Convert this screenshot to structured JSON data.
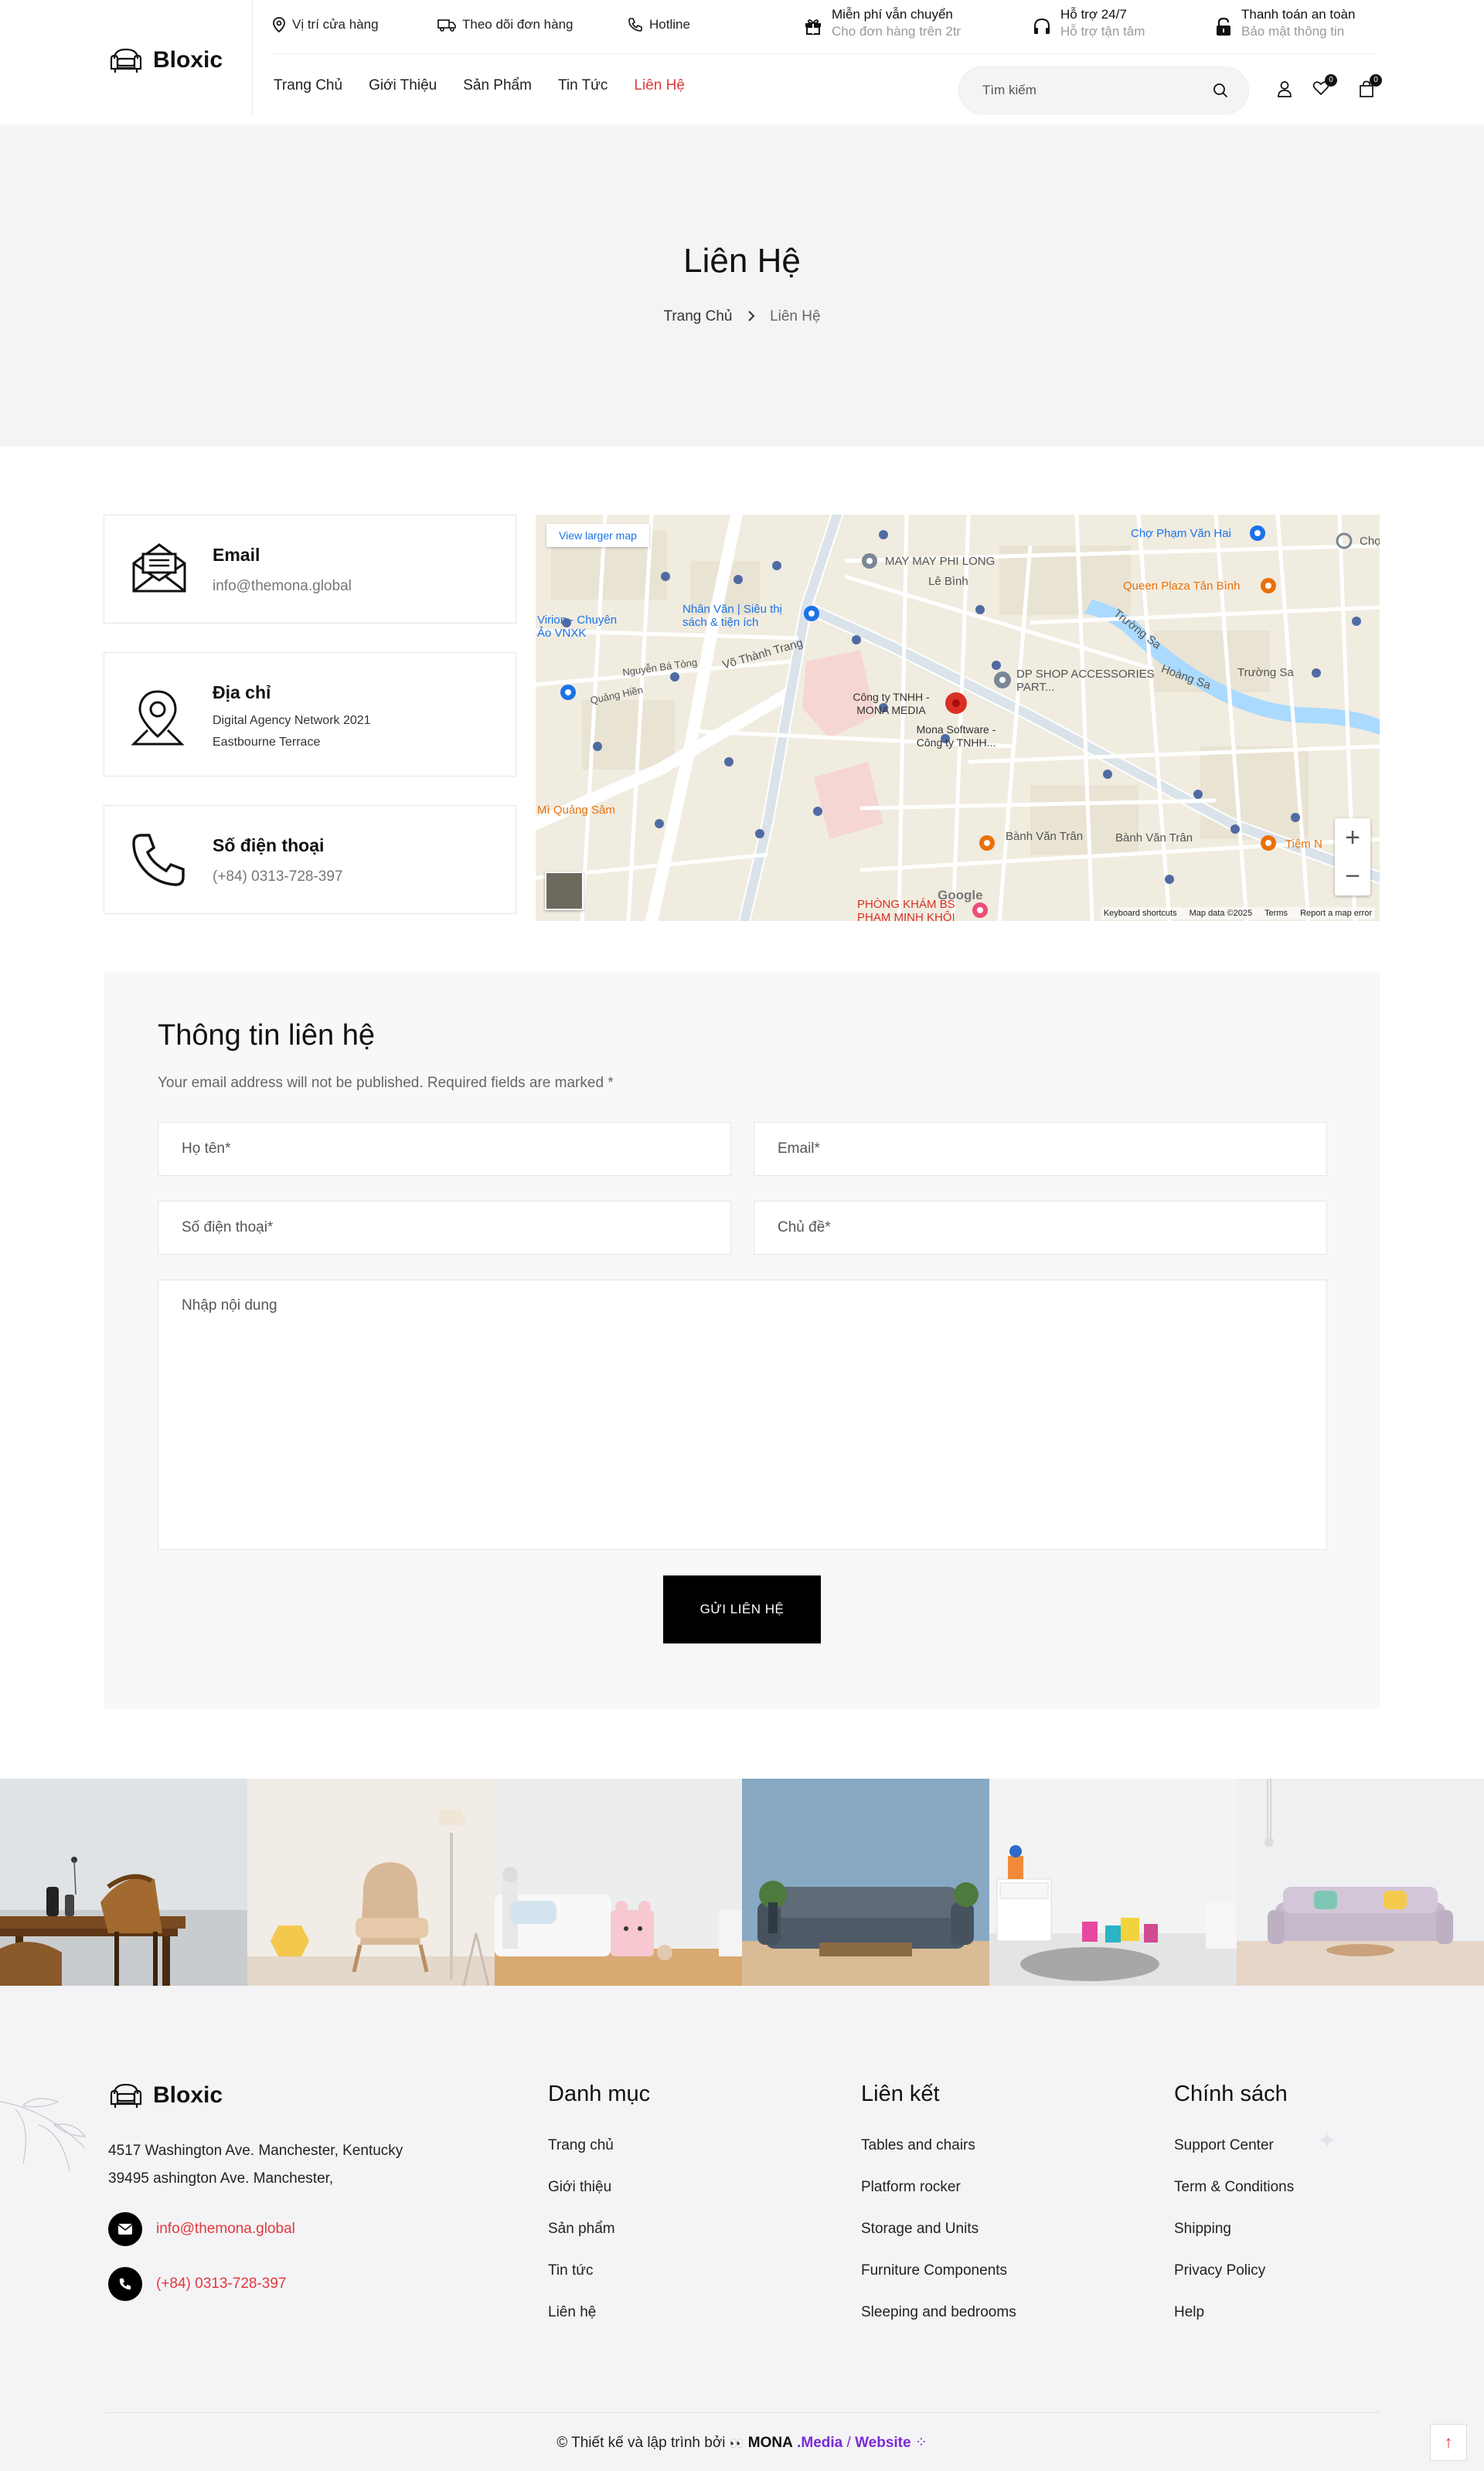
{
  "header": {
    "logo": "Bloxic",
    "top_links": [
      {
        "label": "Vị trí cửa hàng",
        "icon": "location-pin-icon"
      },
      {
        "label": "Theo dõi đơn hàng",
        "icon": "truck-icon"
      },
      {
        "label": "Hotline",
        "icon": "phone-icon"
      }
    ],
    "features": [
      {
        "title": "Miễn phí vẫn chuyển",
        "subtitle": "Cho đơn hàng trên 2tr",
        "icon": "gift-icon"
      },
      {
        "title": "Hỗ trợ 24/7",
        "subtitle": "Hỗ trợ tận tâm",
        "icon": "headphones-icon"
      },
      {
        "title": "Thanh toán an toàn",
        "subtitle": "Bảo mật thông tin",
        "icon": "lock-icon"
      }
    ],
    "nav": [
      "Trang Chủ",
      "Giới Thiệu",
      "Sản Phẩm",
      "Tin Tức",
      "Liên Hệ"
    ],
    "active_nav": "Liên Hệ",
    "search_placeholder": "Tìm kiếm",
    "wishlist_count": "0",
    "cart_count": "0"
  },
  "hero": {
    "title": "Liên Hệ",
    "breadcrumb_home": "Trang Chủ",
    "breadcrumb_current": "Liên Hệ"
  },
  "contact_cards": [
    {
      "title": "Email",
      "value": "info@themona.global",
      "icon": "envelope-icon"
    },
    {
      "title": "Địa chỉ",
      "line1": "Digital Agency Network 2021",
      "line2": "Eastbourne Terrace",
      "icon": "map-pin-icon"
    },
    {
      "title": "Số điện thoại",
      "value": "(+84) 0313-728-397",
      "icon": "phone-icon"
    }
  ],
  "map": {
    "view_larger": "View larger map",
    "labels": {
      "may_phi_long": "MAY MAY PHI LONG",
      "cho_pham_van_hai": "Chợ Phạm Văn Hai",
      "queen_plaza": "Queen Plaza Tân Bình",
      "le_binh": "Lê Bình",
      "nhan_van": "Nhân Văn | Siêu thị sách & tiện ích",
      "virion": "Virion - Chuyên Ảo VNXK",
      "vo_thanh_trang": "Võ Thành Trang",
      "dp_shop": "DP SHOP ACCESSORIES PART...",
      "mona_media": "Công ty TNHH - MONA MEDIA",
      "mona_software": "Mona Software - Công ty TNHH...",
      "banh_van_tran": "Bành Văn Trân",
      "phong_kham": "PHÒNG KHÁM BS PHẠM MINH KHÔI",
      "mi_quang": "Mì Quảng Sâm",
      "truong_sa": "Trường Sa",
      "hoang_sa": "Hoàng Sa",
      "cho": "Chợ",
      "tiem_n": "Tiệm N",
      "quang_hien": "Quảng Hiền",
      "nguyen_ba_tong": "Nguyễn Bá Tòng"
    },
    "google": "Google",
    "footer_links": [
      "Keyboard shortcuts",
      "Map data ©2025",
      "Terms",
      "Report a map error"
    ]
  },
  "form": {
    "title": "Thông tin liên hệ",
    "note": "Your email address will not be published. Required fields are marked *",
    "name_placeholder": "Họ tên*",
    "email_placeholder": "Email*",
    "phone_placeholder": "Số điện thoại*",
    "subject_placeholder": "Chủ đề*",
    "message_placeholder": "Nhập nội dung",
    "submit": "GỬI LIÊN HỆ"
  },
  "footer": {
    "logo": "Bloxic",
    "address_line1": "4517 Washington Ave. Manchester, Kentucky",
    "address_line2": "39495 ashington Ave. Manchester,",
    "email": "info@themona.global",
    "phone": "(+84) 0313-728-397",
    "columns": [
      {
        "title": "Danh mục",
        "links": [
          "Trang chủ",
          "Giới thiệu",
          "Sản phẩm",
          "Tin tức",
          "Liên hệ"
        ]
      },
      {
        "title": "Liên kết",
        "links": [
          "Tables and chairs",
          "Platform rocker",
          "Storage and Units",
          "Furniture Components",
          "Sleeping and bedrooms"
        ]
      },
      {
        "title": "Chính sách",
        "links": [
          "Support Center",
          "Term & Conditions",
          "Shipping",
          "Privacy Policy",
          "Help"
        ]
      }
    ],
    "copyright": "© Thiết kế và lập trình bởi",
    "brand_mona": "MONA",
    "brand_media": ".Media",
    "brand_sep": "/",
    "brand_website": "Website",
    "back_to_top": "↑"
  }
}
